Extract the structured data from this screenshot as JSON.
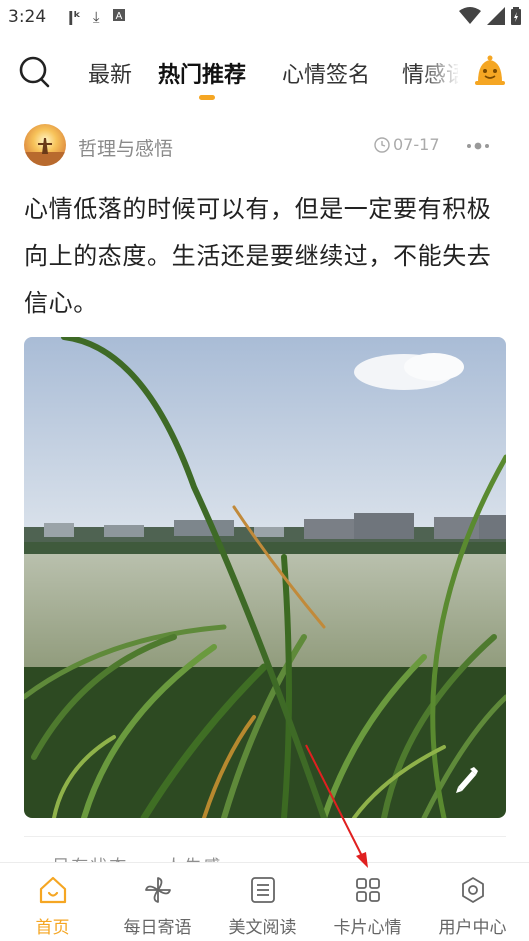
{
  "status_bar": {
    "time": "3:24",
    "left_icons": [
      "k-app-icon",
      "download-icon",
      "a-app-icon"
    ],
    "right_icons": [
      "wifi-icon",
      "signal-icon",
      "battery-icon"
    ]
  },
  "top_nav": {
    "search_icon": "search-icon",
    "tabs": [
      {
        "label": "最新",
        "active": false
      },
      {
        "label": "热门推荐",
        "active": true
      },
      {
        "label": "心情签名",
        "active": false
      },
      {
        "label": "情感语",
        "active": false
      }
    ],
    "bell_icon": "bell-icon",
    "accent_color": "#f5a623"
  },
  "post": {
    "author": "哲理与感悟",
    "date": "07-17",
    "more_icon": "more-icon",
    "text": "心情低落的时候可以有，但是一定要有积极向上的态度。生活还是要继续过，不能失去信心。",
    "image_alt_icon": "edit-pen-icon",
    "next_peek": "...另有状态 ... 人生感"
  },
  "bottom_nav": {
    "items": [
      {
        "label": "首页",
        "icon": "home-icon",
        "active": true
      },
      {
        "label": "每日寄语",
        "icon": "pinwheel-icon",
        "active": false
      },
      {
        "label": "美文阅读",
        "icon": "document-icon",
        "active": false
      },
      {
        "label": "卡片心情",
        "icon": "grid-icon",
        "active": false
      },
      {
        "label": "用户中心",
        "icon": "settings-icon",
        "active": false
      }
    ]
  }
}
